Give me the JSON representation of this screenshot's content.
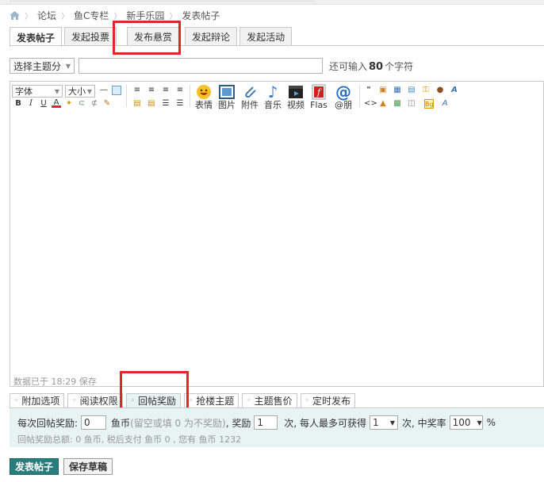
{
  "breadcrumb": [
    "论坛",
    "鱼C专栏",
    "新手乐园",
    "发表帖子"
  ],
  "tabs": [
    "发表帖子",
    "发起投票",
    "发布悬赏",
    "发起辩论",
    "发起活动"
  ],
  "subject": {
    "type_select": "选择主题分",
    "remain_prefix": "还可输入",
    "remain_count": "80",
    "remain_suffix": "个字符"
  },
  "toolbar": {
    "font_label": "字体",
    "size_label": "大小",
    "big_buttons": [
      "表情",
      "图片",
      "附件",
      "音乐",
      "视频",
      "Flas",
      "@朋"
    ]
  },
  "editor": {
    "status": "数据已于 18:29 保存"
  },
  "bottom_tabs": [
    "附加选项",
    "阅读权限",
    "回帖奖励",
    "抢楼主题",
    "主题售价",
    "定时发布"
  ],
  "reward": {
    "label_each": "每次回帖奖励:",
    "each_value": "0",
    "unit": "鱼币",
    "hint": "(留空或填 0 为不奖励)",
    "label_times": ", 奖励",
    "times_value": "1",
    "label_max": "次, 每人最多可获得",
    "max_value": "1",
    "label_rate": "次, 中奖率",
    "rate_value": "100",
    "percent": "%",
    "summary": "回帖奖励总额: 0 鱼币, 税后支付 鱼币 0 , 您有 鱼币 1232"
  },
  "buttons": {
    "submit": "发表帖子",
    "save_draft": "保存草稿"
  },
  "colors": {
    "primary": "#2a7d7d",
    "highlight_red": "#e0252b",
    "panel_bg": "#e8f3f3"
  }
}
